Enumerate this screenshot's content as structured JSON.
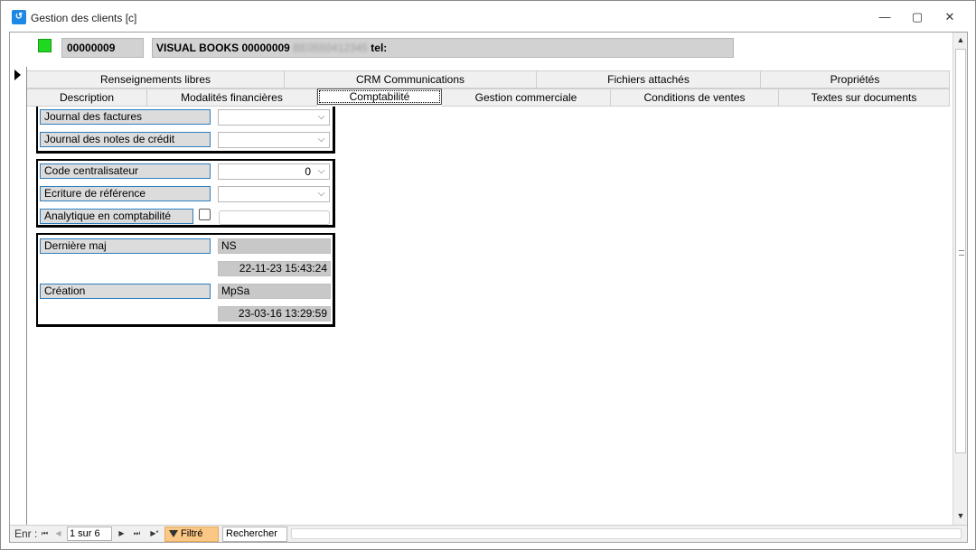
{
  "window": {
    "title": "Gestion des clients [c]",
    "icon": "app-icon",
    "minimize_glyph": "—",
    "maximize_glyph": "▢",
    "close_glyph": "✕"
  },
  "header": {
    "status_color": "#1fd81f",
    "client_code": "00000009",
    "client_name": "VISUAL BOOKS 00000009",
    "client_phone_blurred": "BE0550412345",
    "client_tel_label": "tel:"
  },
  "tabs": {
    "row1": [
      "Renseignements libres",
      "CRM Communications",
      "Fichiers attachés",
      "Propriétés"
    ],
    "row2": [
      "Description",
      "Modalités financières",
      "Comptabilité",
      "Gestion commerciale",
      "Conditions de ventes",
      "Textes sur documents"
    ],
    "active": "Comptabilité"
  },
  "accounting": {
    "group1": {
      "journal_factures_label": "Journal des factures",
      "journal_factures_value": "",
      "journal_notes_credit_label": "Journal des notes de crédit",
      "journal_notes_credit_value": ""
    },
    "group2": {
      "code_centralisateur_label": "Code centralisateur",
      "code_centralisateur_value": "0",
      "ecriture_reference_label": "Ecriture de référence",
      "ecriture_reference_value": "",
      "analytique_label": "Analytique en comptabilité",
      "analytique_checked": false
    },
    "group3": {
      "derniere_maj_label": "Dernière maj",
      "derniere_maj_user": "NS",
      "derniere_maj_date": "22-11-23 15:43:24",
      "creation_label": "Création",
      "creation_user": "MpSa",
      "creation_date": "23-03-16 13:29:59"
    }
  },
  "navigation": {
    "record_label": "Enr :",
    "current": "1 sur 6",
    "filter_label": "Filtré",
    "search_label": "Rechercher",
    "first_glyph": "⏮",
    "prev_glyph": "◀",
    "next_glyph": "▶",
    "last_glyph": "⏭",
    "new_glyph": "▶*"
  },
  "scrollbar": {
    "up_glyph": "▲",
    "down_glyph": "▼"
  },
  "combo_arrow": "⌵"
}
